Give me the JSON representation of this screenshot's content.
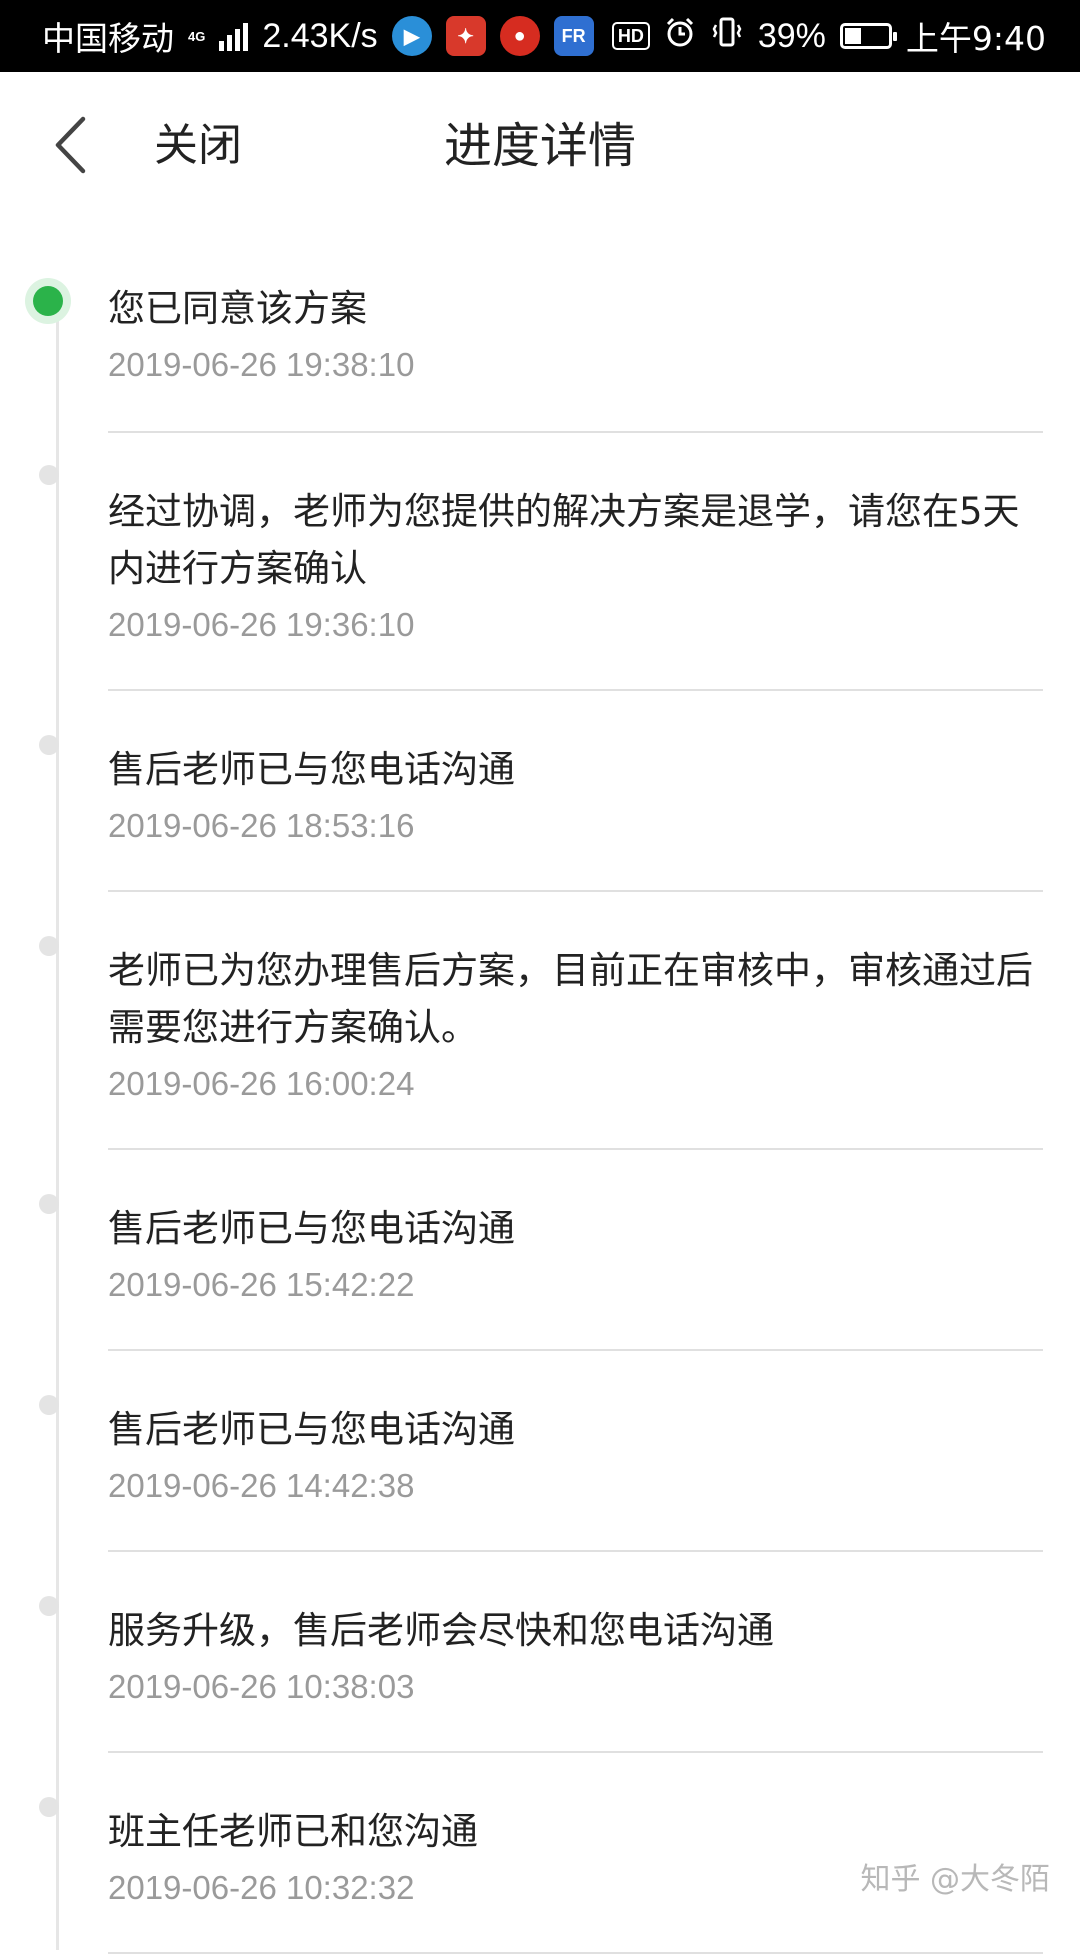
{
  "status_bar": {
    "carrier": "中国移动",
    "network_type": "4G",
    "data_rate": "2.43K/s",
    "battery_percent": "39%",
    "battery_level": 0.39,
    "time": "上午9:40",
    "hd_label": "HD",
    "app_icons": [
      "video-app-icon",
      "shopping-app-icon",
      "jd-app-icon",
      "fr-app-icon"
    ]
  },
  "nav": {
    "back_icon": "chevron-left-icon",
    "close_label": "关闭",
    "title": "进度详情"
  },
  "colors": {
    "active_dot": "#2bb34a",
    "inactive_dot": "#e4e4e4",
    "timestamp": "#9a9a9a"
  },
  "timeline": [
    {
      "text": "您已同意该方案",
      "time": "2019-06-26 19:38:10",
      "active": true
    },
    {
      "text": "经过协调，老师为您提供的解决方案是退学，请您在5天内进行方案确认",
      "time": "2019-06-26 19:36:10",
      "active": false
    },
    {
      "text": "售后老师已与您电话沟通",
      "time": "2019-06-26 18:53:16",
      "active": false
    },
    {
      "text": "老师已为您办理售后方案，目前正在审核中，审核通过后需要您进行方案确认。",
      "time": "2019-06-26 16:00:24",
      "active": false
    },
    {
      "text": "售后老师已与您电话沟通",
      "time": "2019-06-26 15:42:22",
      "active": false
    },
    {
      "text": "售后老师已与您电话沟通",
      "time": "2019-06-26 14:42:38",
      "active": false
    },
    {
      "text": "服务升级，售后老师会尽快和您电话沟通",
      "time": "2019-06-26 10:38:03",
      "active": false
    },
    {
      "text": "班主任老师已和您沟通",
      "time": "2019-06-26 10:32:32",
      "active": false
    }
  ],
  "watermark": "知乎 @大冬陌"
}
